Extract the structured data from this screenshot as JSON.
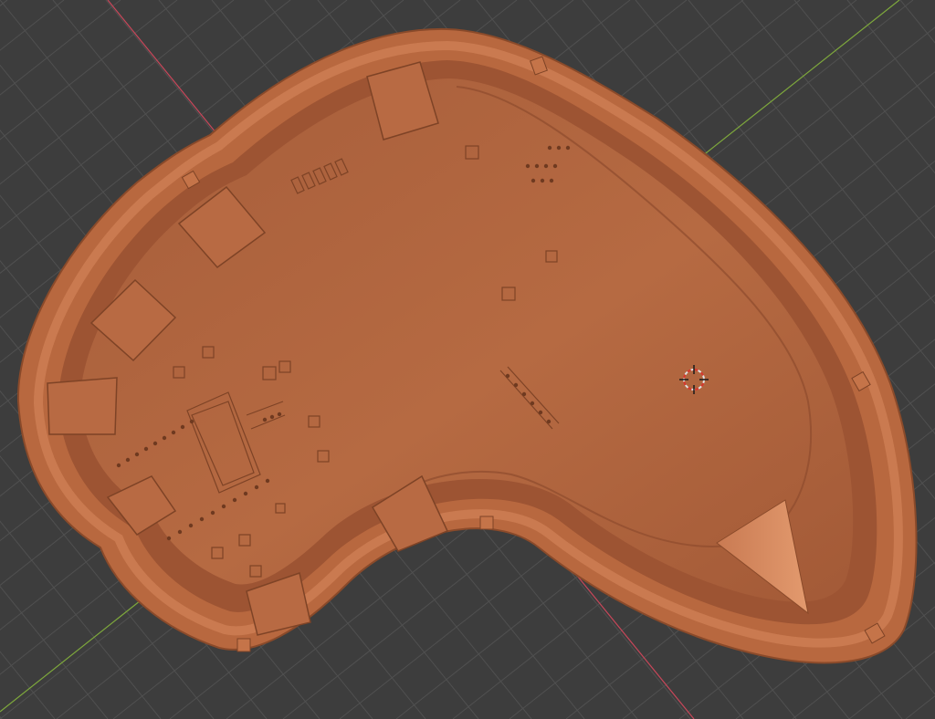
{
  "viewport": {
    "background": "#3d3d3d",
    "grid_color": "#505050",
    "x_axis_color": "#c8475a",
    "y_axis_color": "#7ea83c"
  },
  "object": {
    "material_color": "#b4673f",
    "rim_color": "#c26f45",
    "shadow_color": "#8b4b2c",
    "highlight_color": "#d98b5f"
  },
  "cursor": {
    "icon": "3d-cursor-icon",
    "ring_color_a": "#e0e0e0",
    "ring_color_b": "#d8362e"
  }
}
